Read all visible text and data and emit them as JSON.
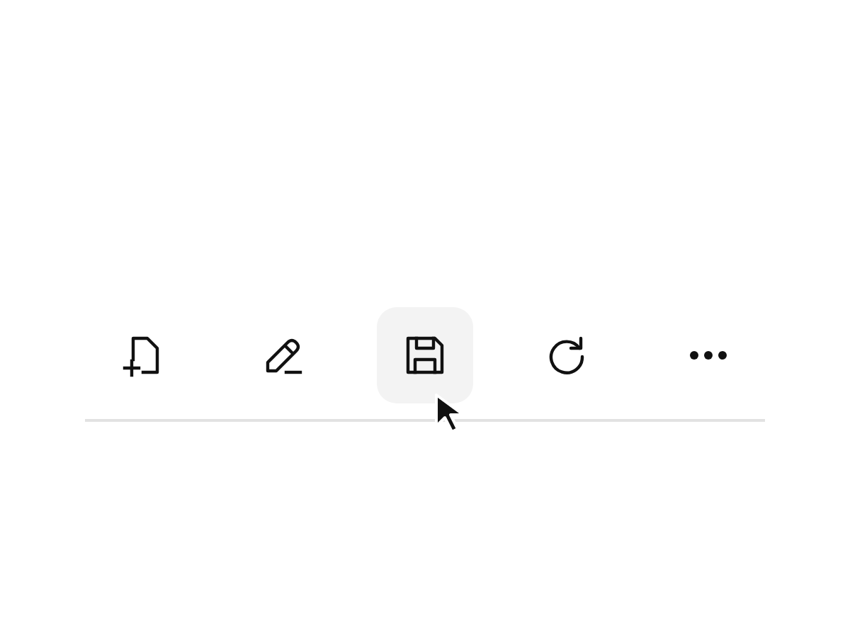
{
  "toolbar": {
    "buttons": [
      {
        "kind": "new-file",
        "hovered": false
      },
      {
        "kind": "edit",
        "hovered": false
      },
      {
        "kind": "save",
        "hovered": true
      },
      {
        "kind": "refresh",
        "hovered": false
      },
      {
        "kind": "more",
        "hovered": false
      }
    ]
  }
}
